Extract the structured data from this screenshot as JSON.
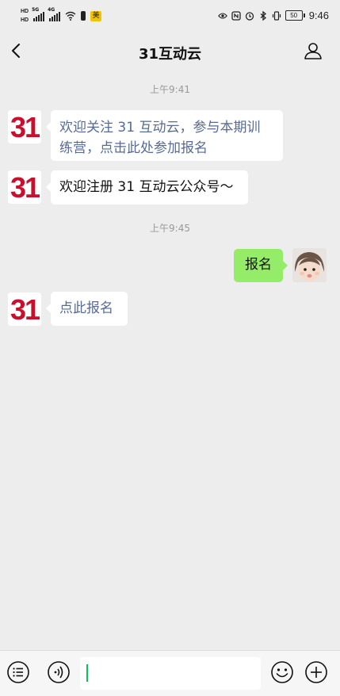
{
  "status_bar": {
    "hd1": "HD",
    "hd2": "HD",
    "net1": "5G",
    "net2": "4G",
    "badge": "美",
    "battery": "50",
    "time": "9:46"
  },
  "header": {
    "title": "31互动云"
  },
  "messages": {
    "time1": "上午9:41",
    "msg1_line1": "欢迎关注 31 互动云，参与本期训",
    "msg1_line2": "练营，点击此处参加报名",
    "msg2": "欢迎注册 31 互动云公众号～",
    "time2": "上午9:45",
    "msg3": "报名",
    "msg4": "点此报名",
    "avatar_text": "31"
  },
  "input": {
    "value": ""
  },
  "colors": {
    "link": "#576b95",
    "bubble_sent": "#95ec69",
    "logo_red": "#c8102e",
    "caret": "#07c160"
  },
  "icons": [
    "back-icon",
    "person-icon",
    "list-menu-icon",
    "voice-icon",
    "emoji-icon",
    "plus-icon"
  ]
}
